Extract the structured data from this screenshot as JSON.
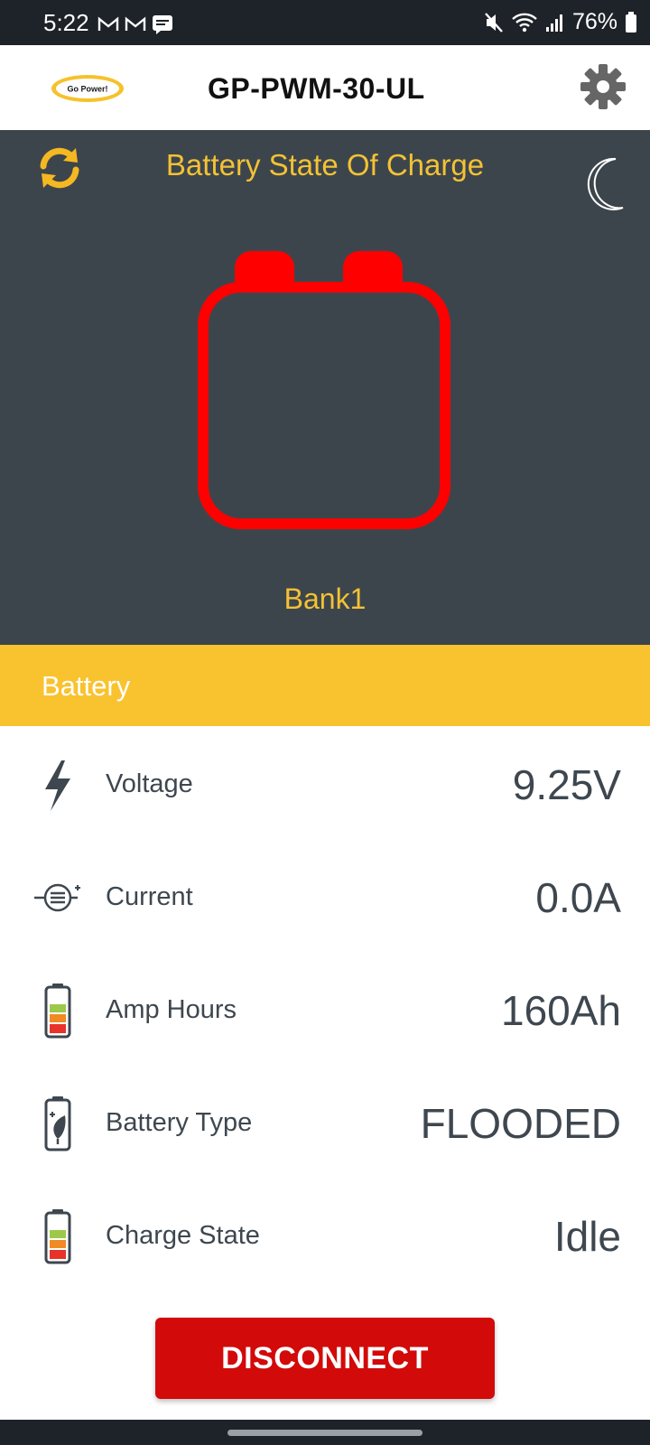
{
  "status_bar": {
    "time": "5:22",
    "battery_percent": "76%",
    "left_icons": [
      "gmail-icon",
      "gmail-icon",
      "message-icon"
    ],
    "right_icons": [
      "mute-icon",
      "wifi-icon",
      "signal-icon",
      "battery-icon"
    ]
  },
  "header": {
    "logo_text": "Go Power!",
    "title": "GP-PWM-30-UL",
    "settings_icon": "gear-icon"
  },
  "panel": {
    "title": "Battery State Of Charge",
    "bank_label": "Bank1",
    "refresh_icon": "refresh-icon",
    "theme_icon": "moon-icon",
    "battery_color": "#ff0000"
  },
  "section": {
    "label": "Battery"
  },
  "rows": [
    {
      "label": "Voltage",
      "value": "9.25V",
      "icon": "lightning-icon"
    },
    {
      "label": "Current",
      "value": "0.0A",
      "icon": "current-icon"
    },
    {
      "label": "Amp Hours",
      "value": "160Ah",
      "icon": "battery-level-icon"
    },
    {
      "label": "Battery Type",
      "value": "FLOODED",
      "icon": "battery-leaf-icon"
    },
    {
      "label": "Charge State",
      "value": "Idle",
      "icon": "battery-level-icon"
    }
  ],
  "button": {
    "label": "DISCONNECT"
  },
  "colors": {
    "accent": "#f9c22f",
    "panel_bg": "#3d454c",
    "button": "#d20a0a",
    "text": "#3e474f"
  }
}
